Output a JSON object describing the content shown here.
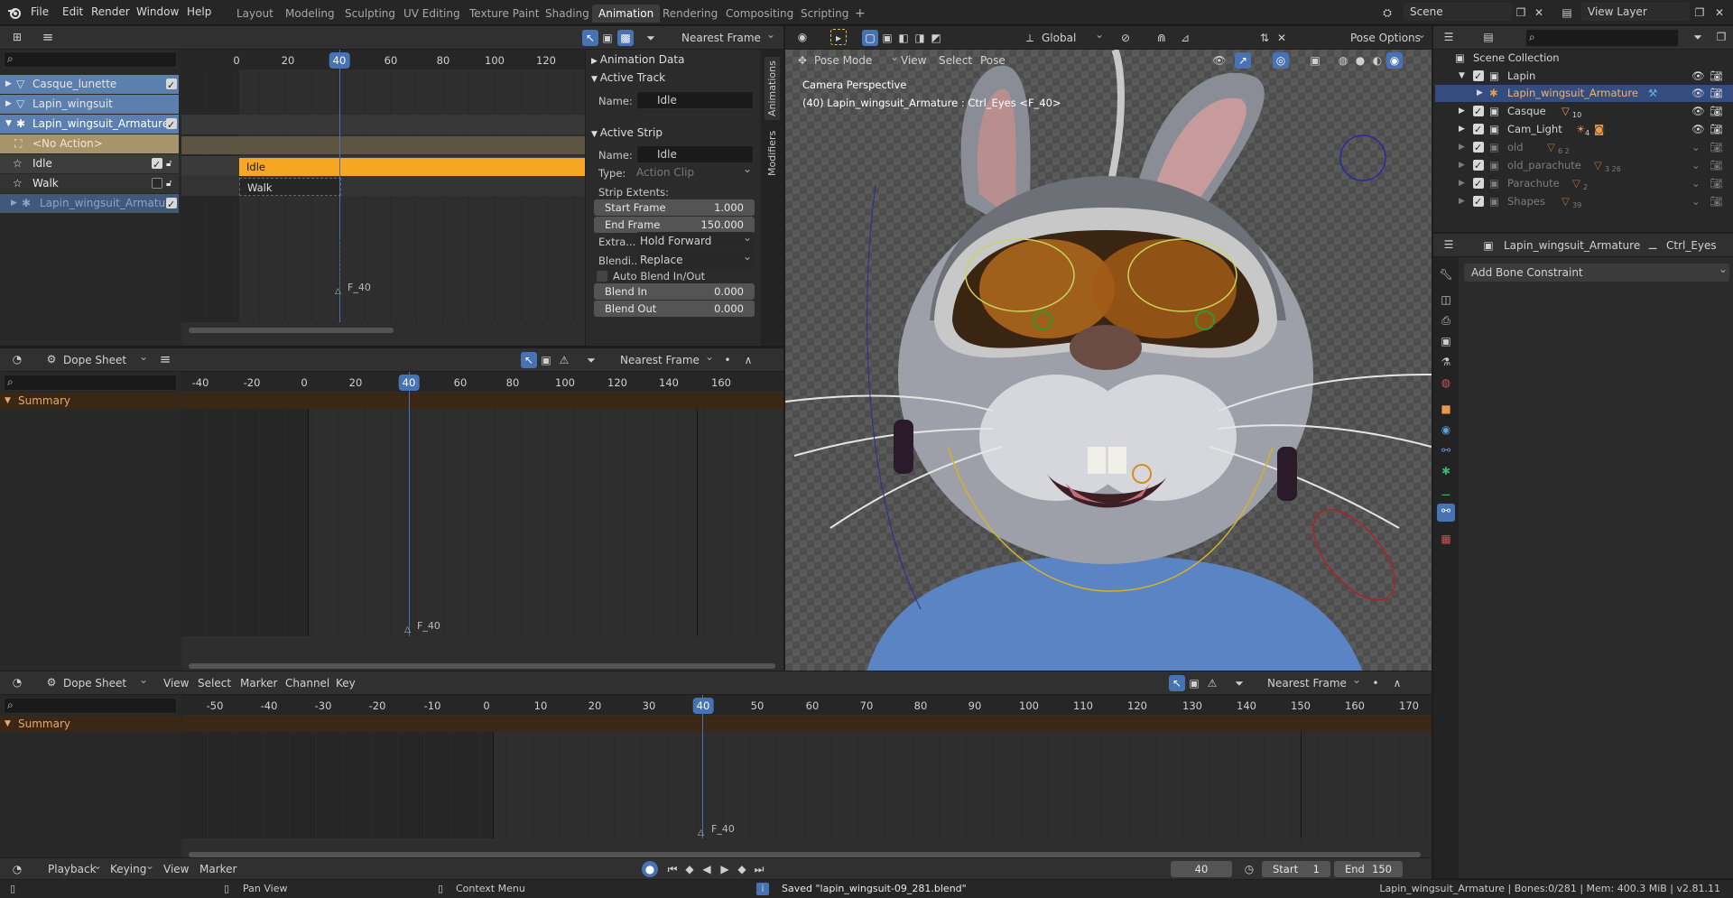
{
  "top_menu": [
    "File",
    "Edit",
    "Render",
    "Window",
    "Help"
  ],
  "workspace_tabs": [
    "Layout",
    "Modeling",
    "Sculpting",
    "UV Editing",
    "Texture Paint",
    "Shading",
    "Animation",
    "Rendering",
    "Compositing",
    "Scripting",
    "+"
  ],
  "active_workspace": "Animation",
  "scene": {
    "name": "Scene",
    "view_layer": "View Layer"
  },
  "nla": {
    "snap_mode": "Nearest Frame",
    "ruler": [
      "0",
      "20",
      "40",
      "60",
      "80",
      "100",
      "120"
    ],
    "current_frame": "40",
    "marker": "F_40",
    "channels": [
      {
        "label": "Casque_lunette",
        "kind": "object"
      },
      {
        "label": "Lapin_wingsuit",
        "kind": "object"
      },
      {
        "label": "Lapin_wingsuit_Armature",
        "kind": "armature"
      },
      {
        "label": "<No Action>",
        "kind": "action"
      },
      {
        "label": "Idle",
        "kind": "track"
      },
      {
        "label": "Walk",
        "kind": "track"
      },
      {
        "label": "Lapin_wingsuit_Armature",
        "kind": "armature-dim"
      }
    ],
    "strips": {
      "idle": "Idle",
      "walk": "Walk"
    }
  },
  "sidebar": {
    "tabs": [
      "Animations",
      "Modifiers"
    ],
    "animation_data": "Animation Data",
    "active_track": {
      "header": "Active Track",
      "name_label": "Name:",
      "name": "Idle"
    },
    "active_strip": {
      "header": "Active Strip",
      "name_label": "Name:",
      "name": "Idle",
      "type_label": "Type:",
      "type": "Action Clip",
      "extents_label": "Strip Extents:",
      "start_label": "Start Frame",
      "start": "1.000",
      "end_label": "End Frame",
      "end": "150.000",
      "extra_label": "Extra...",
      "extra": "Hold Forward",
      "blend_label": "Blendi...",
      "blend": "Replace",
      "auto_blend": "Auto Blend In/Out",
      "blend_in_label": "Blend In",
      "blend_in": "0.000",
      "blend_out_label": "Blend Out",
      "blend_out": "0.000"
    }
  },
  "dopesheet1": {
    "mode": "Dope Sheet",
    "snap_mode": "Nearest Frame",
    "ruler": [
      "-40",
      "-20",
      "0",
      "20",
      "40",
      "60",
      "80",
      "100",
      "120",
      "140",
      "160"
    ],
    "current_frame": "40",
    "summary": "Summary",
    "marker": "F_40"
  },
  "viewport": {
    "mode": "Pose Mode",
    "menus": [
      "View",
      "Select",
      "Pose"
    ],
    "orientation": "Global",
    "pose_options": "Pose Options",
    "camera_label": "Camera Perspective",
    "object_info": "(40) Lapin_wingsuit_Armature : Ctrl_Eyes <F_40>"
  },
  "outliner": {
    "collection": "Scene Collection",
    "items": [
      {
        "label": "Lapin",
        "indent": 1,
        "visible": true
      },
      {
        "label": "Lapin_wingsuit_Armature",
        "indent": 2,
        "visible": true,
        "selected": true
      },
      {
        "label": "Casque",
        "indent": 1,
        "visible": true,
        "badge": "10"
      },
      {
        "label": "Cam_Light",
        "indent": 1,
        "visible": true,
        "badge": "4"
      },
      {
        "label": "old",
        "indent": 1,
        "visible": false,
        "badge": "6  2"
      },
      {
        "label": "old_parachute",
        "indent": 1,
        "visible": false,
        "badge": "3  26"
      },
      {
        "label": "Parachute",
        "indent": 1,
        "visible": false,
        "badge": "2"
      },
      {
        "label": "Shapes",
        "indent": 1,
        "visible": false,
        "badge": "39"
      }
    ]
  },
  "properties": {
    "object": "Lapin_wingsuit_Armature",
    "bone": "Ctrl_Eyes",
    "add_constraint": "Add Bone Constraint"
  },
  "dopesheet2": {
    "mode": "Dope Sheet",
    "menus": [
      "View",
      "Select",
      "Marker",
      "Channel",
      "Key"
    ],
    "snap_mode": "Nearest Frame",
    "ruler": [
      "-50",
      "-40",
      "-30",
      "-20",
      "-10",
      "0",
      "10",
      "20",
      "30",
      "40",
      "50",
      "60",
      "70",
      "80",
      "90",
      "100",
      "110",
      "120",
      "130",
      "140",
      "150",
      "160",
      "170"
    ],
    "current_frame": "40",
    "summary": "Summary",
    "marker": "F_40"
  },
  "timeline": {
    "menus": [
      "Playback",
      "Keying",
      "View",
      "Marker"
    ],
    "frame": "40",
    "start_label": "Start",
    "start": "1",
    "end_label": "End",
    "end": "150"
  },
  "statusbar": {
    "pan": "Pan View",
    "context": "Context Menu",
    "message": "Saved \"lapin_wingsuit-09_281.blend\"",
    "info": "Lapin_wingsuit_Armature | Bones:0/281 | Mem: 400.3 MiB | v2.81.11"
  },
  "colors": {
    "accent": "#4772b3",
    "strip": "#f5a623",
    "summary": "#3a2716",
    "track": "#a8946b"
  }
}
